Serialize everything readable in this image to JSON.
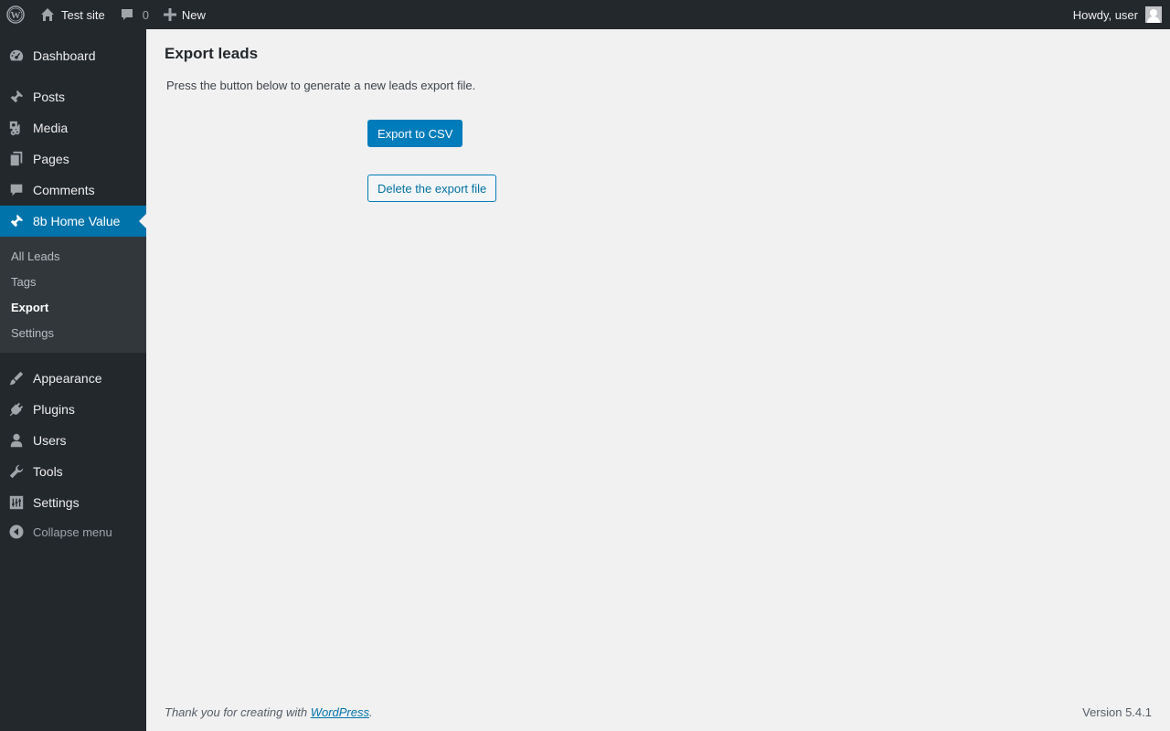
{
  "adminbar": {
    "site_name": "Test site",
    "comments_count": "0",
    "new_label": "New",
    "howdy": "Howdy, user"
  },
  "sidebar": {
    "items": [
      {
        "label": "Dashboard",
        "icon": "dashboard-icon"
      },
      {
        "label": "Posts",
        "icon": "pin-icon"
      },
      {
        "label": "Media",
        "icon": "media-icon"
      },
      {
        "label": "Pages",
        "icon": "pages-icon"
      },
      {
        "label": "Comments",
        "icon": "comment-icon"
      },
      {
        "label": "8b Home Value",
        "icon": "pin-icon",
        "current": true
      },
      {
        "label": "Appearance",
        "icon": "brush-icon"
      },
      {
        "label": "Plugins",
        "icon": "plug-icon"
      },
      {
        "label": "Users",
        "icon": "user-icon"
      },
      {
        "label": "Tools",
        "icon": "wrench-icon"
      },
      {
        "label": "Settings",
        "icon": "settings-icon"
      }
    ],
    "submenu": [
      {
        "label": "All Leads"
      },
      {
        "label": "Tags"
      },
      {
        "label": "Export",
        "active": true
      },
      {
        "label": "Settings"
      }
    ],
    "collapse_label": "Collapse menu"
  },
  "main": {
    "title": "Export leads",
    "description": "Press the button below to generate a new leads export file.",
    "export_button": "Export to CSV",
    "delete_button": "Delete the export file"
  },
  "footer": {
    "thanks_prefix": "Thank you for creating with ",
    "link_text": "WordPress",
    "thanks_suffix": ".",
    "version": "Version 5.4.1"
  },
  "colors": {
    "adminbar_bg": "#23282d",
    "sidebar_bg": "#23282d",
    "accent": "#0073aa",
    "button_primary": "#007cba",
    "page_bg": "#f1f1f1"
  }
}
